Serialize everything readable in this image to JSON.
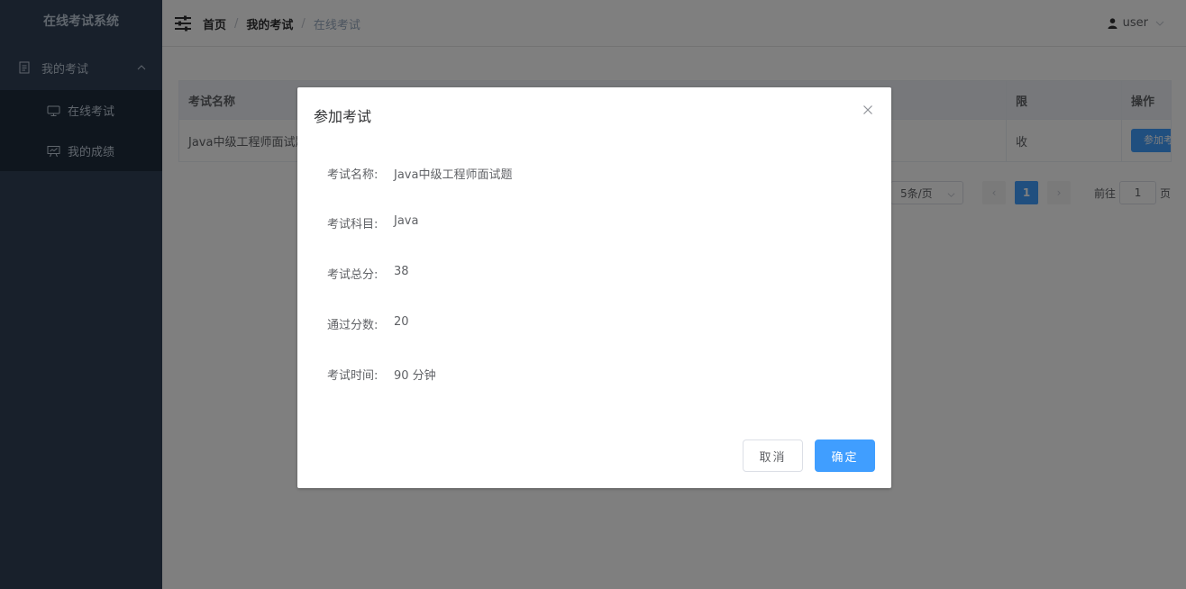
{
  "app": {
    "title": "在线考试系统"
  },
  "sidebar": {
    "group": {
      "label": "我的考试",
      "icon": "document-icon"
    },
    "items": [
      {
        "label": "在线考试",
        "icon": "monitor-icon"
      },
      {
        "label": "我的成绩",
        "icon": "presentation-board-icon"
      }
    ]
  },
  "navbar": {
    "breadcrumb": [
      "首页",
      "我的考试",
      "在线考试"
    ],
    "separator": "/",
    "user": "user"
  },
  "table": {
    "headers": [
      "考试名称",
      "",
      "",
      "限",
      "操作"
    ],
    "rows": [
      {
        "name": "Java中级工程师面试题",
        "col4": "收",
        "action": "参加考试"
      }
    ]
  },
  "pagination": {
    "page_size": "5条/页",
    "current_page": "1",
    "goto_label": "前往",
    "goto_value": "1",
    "page_unit": "页",
    "prev": "‹",
    "next": "›"
  },
  "dialog": {
    "title": "参加考试",
    "fields": [
      {
        "label": "考试名称:",
        "value": "Java中级工程师面试题"
      },
      {
        "label": "考试科目:",
        "value": "Java"
      },
      {
        "label": "考试总分:",
        "value": "38"
      },
      {
        "label": "通过分数:",
        "value": "20"
      },
      {
        "label": "考试时间:",
        "value": "90 分钟"
      }
    ],
    "cancel_label": "取消",
    "ok_label": "确定"
  },
  "colors": {
    "sidebar_bg": "#304156",
    "submenu_bg": "#1f2d3d",
    "primary": "#409eff"
  }
}
